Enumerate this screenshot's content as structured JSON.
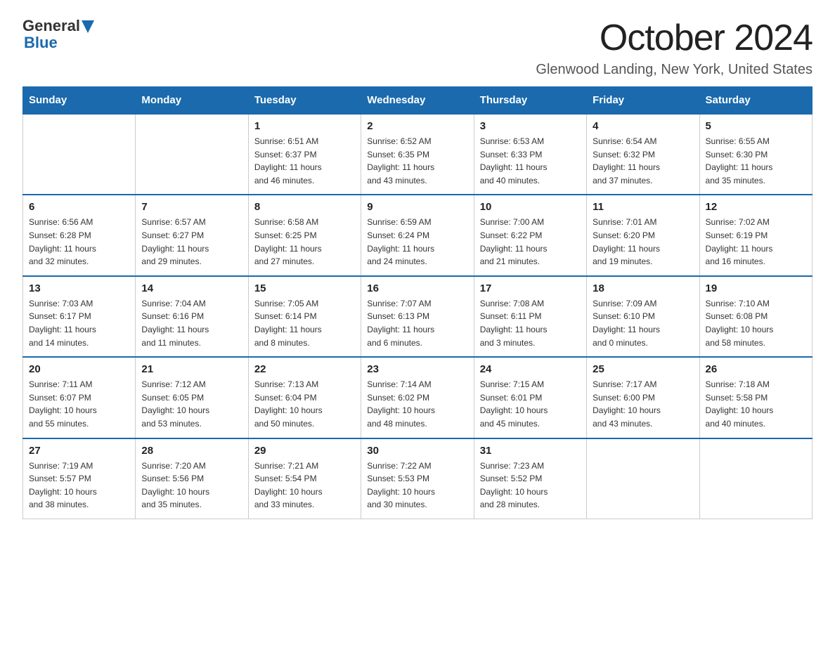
{
  "header": {
    "logo_general": "General",
    "logo_blue": "Blue",
    "title": "October 2024",
    "subtitle": "Glenwood Landing, New York, United States"
  },
  "days_of_week": [
    "Sunday",
    "Monday",
    "Tuesday",
    "Wednesday",
    "Thursday",
    "Friday",
    "Saturday"
  ],
  "weeks": [
    [
      {
        "day": "",
        "info": ""
      },
      {
        "day": "",
        "info": ""
      },
      {
        "day": "1",
        "info": "Sunrise: 6:51 AM\nSunset: 6:37 PM\nDaylight: 11 hours\nand 46 minutes."
      },
      {
        "day": "2",
        "info": "Sunrise: 6:52 AM\nSunset: 6:35 PM\nDaylight: 11 hours\nand 43 minutes."
      },
      {
        "day": "3",
        "info": "Sunrise: 6:53 AM\nSunset: 6:33 PM\nDaylight: 11 hours\nand 40 minutes."
      },
      {
        "day": "4",
        "info": "Sunrise: 6:54 AM\nSunset: 6:32 PM\nDaylight: 11 hours\nand 37 minutes."
      },
      {
        "day": "5",
        "info": "Sunrise: 6:55 AM\nSunset: 6:30 PM\nDaylight: 11 hours\nand 35 minutes."
      }
    ],
    [
      {
        "day": "6",
        "info": "Sunrise: 6:56 AM\nSunset: 6:28 PM\nDaylight: 11 hours\nand 32 minutes."
      },
      {
        "day": "7",
        "info": "Sunrise: 6:57 AM\nSunset: 6:27 PM\nDaylight: 11 hours\nand 29 minutes."
      },
      {
        "day": "8",
        "info": "Sunrise: 6:58 AM\nSunset: 6:25 PM\nDaylight: 11 hours\nand 27 minutes."
      },
      {
        "day": "9",
        "info": "Sunrise: 6:59 AM\nSunset: 6:24 PM\nDaylight: 11 hours\nand 24 minutes."
      },
      {
        "day": "10",
        "info": "Sunrise: 7:00 AM\nSunset: 6:22 PM\nDaylight: 11 hours\nand 21 minutes."
      },
      {
        "day": "11",
        "info": "Sunrise: 7:01 AM\nSunset: 6:20 PM\nDaylight: 11 hours\nand 19 minutes."
      },
      {
        "day": "12",
        "info": "Sunrise: 7:02 AM\nSunset: 6:19 PM\nDaylight: 11 hours\nand 16 minutes."
      }
    ],
    [
      {
        "day": "13",
        "info": "Sunrise: 7:03 AM\nSunset: 6:17 PM\nDaylight: 11 hours\nand 14 minutes."
      },
      {
        "day": "14",
        "info": "Sunrise: 7:04 AM\nSunset: 6:16 PM\nDaylight: 11 hours\nand 11 minutes."
      },
      {
        "day": "15",
        "info": "Sunrise: 7:05 AM\nSunset: 6:14 PM\nDaylight: 11 hours\nand 8 minutes."
      },
      {
        "day": "16",
        "info": "Sunrise: 7:07 AM\nSunset: 6:13 PM\nDaylight: 11 hours\nand 6 minutes."
      },
      {
        "day": "17",
        "info": "Sunrise: 7:08 AM\nSunset: 6:11 PM\nDaylight: 11 hours\nand 3 minutes."
      },
      {
        "day": "18",
        "info": "Sunrise: 7:09 AM\nSunset: 6:10 PM\nDaylight: 11 hours\nand 0 minutes."
      },
      {
        "day": "19",
        "info": "Sunrise: 7:10 AM\nSunset: 6:08 PM\nDaylight: 10 hours\nand 58 minutes."
      }
    ],
    [
      {
        "day": "20",
        "info": "Sunrise: 7:11 AM\nSunset: 6:07 PM\nDaylight: 10 hours\nand 55 minutes."
      },
      {
        "day": "21",
        "info": "Sunrise: 7:12 AM\nSunset: 6:05 PM\nDaylight: 10 hours\nand 53 minutes."
      },
      {
        "day": "22",
        "info": "Sunrise: 7:13 AM\nSunset: 6:04 PM\nDaylight: 10 hours\nand 50 minutes."
      },
      {
        "day": "23",
        "info": "Sunrise: 7:14 AM\nSunset: 6:02 PM\nDaylight: 10 hours\nand 48 minutes."
      },
      {
        "day": "24",
        "info": "Sunrise: 7:15 AM\nSunset: 6:01 PM\nDaylight: 10 hours\nand 45 minutes."
      },
      {
        "day": "25",
        "info": "Sunrise: 7:17 AM\nSunset: 6:00 PM\nDaylight: 10 hours\nand 43 minutes."
      },
      {
        "day": "26",
        "info": "Sunrise: 7:18 AM\nSunset: 5:58 PM\nDaylight: 10 hours\nand 40 minutes."
      }
    ],
    [
      {
        "day": "27",
        "info": "Sunrise: 7:19 AM\nSunset: 5:57 PM\nDaylight: 10 hours\nand 38 minutes."
      },
      {
        "day": "28",
        "info": "Sunrise: 7:20 AM\nSunset: 5:56 PM\nDaylight: 10 hours\nand 35 minutes."
      },
      {
        "day": "29",
        "info": "Sunrise: 7:21 AM\nSunset: 5:54 PM\nDaylight: 10 hours\nand 33 minutes."
      },
      {
        "day": "30",
        "info": "Sunrise: 7:22 AM\nSunset: 5:53 PM\nDaylight: 10 hours\nand 30 minutes."
      },
      {
        "day": "31",
        "info": "Sunrise: 7:23 AM\nSunset: 5:52 PM\nDaylight: 10 hours\nand 28 minutes."
      },
      {
        "day": "",
        "info": ""
      },
      {
        "day": "",
        "info": ""
      }
    ]
  ]
}
